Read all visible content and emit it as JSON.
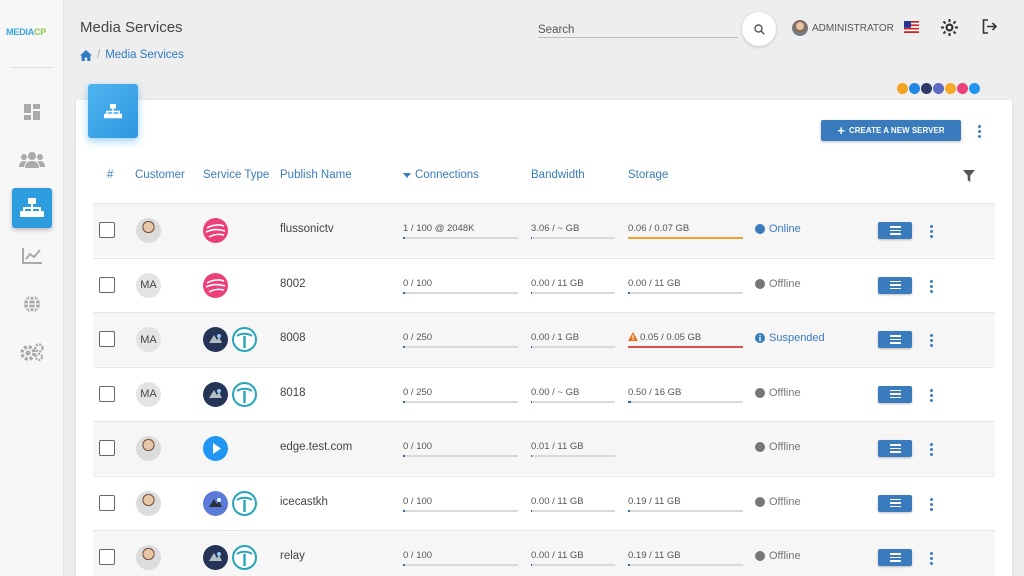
{
  "app": {
    "logo_prefix": "MEDIA",
    "logo_suffix": "CP"
  },
  "header": {
    "title": "Media Services",
    "breadcrumb": "Media Services",
    "search_placeholder": "Search",
    "user_name": "ADMINISTRATOR"
  },
  "sidebar": {
    "items": [
      {
        "icon": "dashboard-icon"
      },
      {
        "icon": "customers-icon"
      },
      {
        "icon": "sitemap-icon",
        "active": true
      },
      {
        "icon": "chart-icon"
      },
      {
        "icon": "globe-icon"
      },
      {
        "icon": "settings-icon"
      }
    ]
  },
  "toolbar": {
    "create_label": "CREATE A NEW SERVER"
  },
  "table": {
    "columns": [
      "#",
      "Customer",
      "Service Type",
      "Publish Name",
      "Connections",
      "Bandwidth",
      "Storage"
    ],
    "rows": [
      {
        "customer": "",
        "photo": true,
        "services": [
          "flussonic"
        ],
        "publish": "flussonictv",
        "connections": "1 / 100 @ 2048K",
        "conn_fill": 0.01,
        "bandwidth": "3.06 / ~ GB",
        "bw_fill": 0,
        "storage": "0.06 / 0.07 GB",
        "storage_fill": 1.0,
        "storage_color": "#f0a030",
        "storage_warn": false,
        "status": "Online",
        "status_color": "#3a7bbd"
      },
      {
        "customer": "MA",
        "photo": false,
        "services": [
          "flussonic"
        ],
        "publish": "8002",
        "connections": "0 / 100",
        "conn_fill": 0.0,
        "bandwidth": "0.00 / 11 GB",
        "bw_fill": 0.0,
        "storage": "0.00 / 11 GB",
        "storage_fill": 0.0,
        "storage_color": "#2e6da4",
        "storage_warn": false,
        "status": "Offline",
        "status_color": "#777777"
      },
      {
        "customer": "MA",
        "photo": false,
        "services": [
          "shoutcast",
          "icecast"
        ],
        "publish": "8008",
        "connections": "0 / 250",
        "conn_fill": 0.0,
        "bandwidth": "0.00 / 1 GB",
        "bw_fill": 0.0,
        "storage": "0.05 / 0.05 GB",
        "storage_fill": 1.0,
        "storage_color": "#d9534f",
        "storage_warn": true,
        "status": "Suspended",
        "status_color": "#3a7bbd"
      },
      {
        "customer": "MA",
        "photo": false,
        "services": [
          "shoutcast",
          "icecast"
        ],
        "publish": "8018",
        "connections": "0 / 250",
        "conn_fill": 0.0,
        "bandwidth": "0.00 / ~ GB",
        "bw_fill": 0.0,
        "storage": "0.50 / 16 GB",
        "storage_fill": 0.03,
        "storage_color": "#2e6da4",
        "storage_warn": false,
        "status": "Offline",
        "status_color": "#777777"
      },
      {
        "customer": "",
        "photo": true,
        "services": [
          "edge"
        ],
        "publish": "edge.test.com",
        "connections": "0 / 100",
        "conn_fill": 0.0,
        "bandwidth": "0.01 / 11 GB",
        "bw_fill": 0.01,
        "storage": "",
        "storage_fill": null,
        "storage_color": "#2e6da4",
        "storage_warn": false,
        "status": "Offline",
        "status_color": "#777777"
      },
      {
        "customer": "",
        "photo": true,
        "services": [
          "shoutcast-light",
          "icecast"
        ],
        "publish": "icecastkh",
        "connections": "0 / 100",
        "conn_fill": 0.0,
        "bandwidth": "0.00 / 11 GB",
        "bw_fill": 0.0,
        "storage": "0.19 / 11 GB",
        "storage_fill": 0.02,
        "storage_color": "#2e6da4",
        "storage_warn": false,
        "status": "Offline",
        "status_color": "#777777"
      },
      {
        "customer": "",
        "photo": true,
        "services": [
          "shoutcast",
          "icecast"
        ],
        "publish": "relay",
        "connections": "0 / 100",
        "conn_fill": 0.0,
        "bandwidth": "0.00 / 11 GB",
        "bw_fill": 0.0,
        "storage": "0.19 / 11 GB",
        "storage_fill": 0.02,
        "storage_color": "#2e6da4",
        "storage_warn": false,
        "status": "Offline",
        "status_color": "#777777"
      }
    ]
  },
  "colors": {
    "accent": "#3a7bbd",
    "sidebar_active": "#2d9de0"
  }
}
